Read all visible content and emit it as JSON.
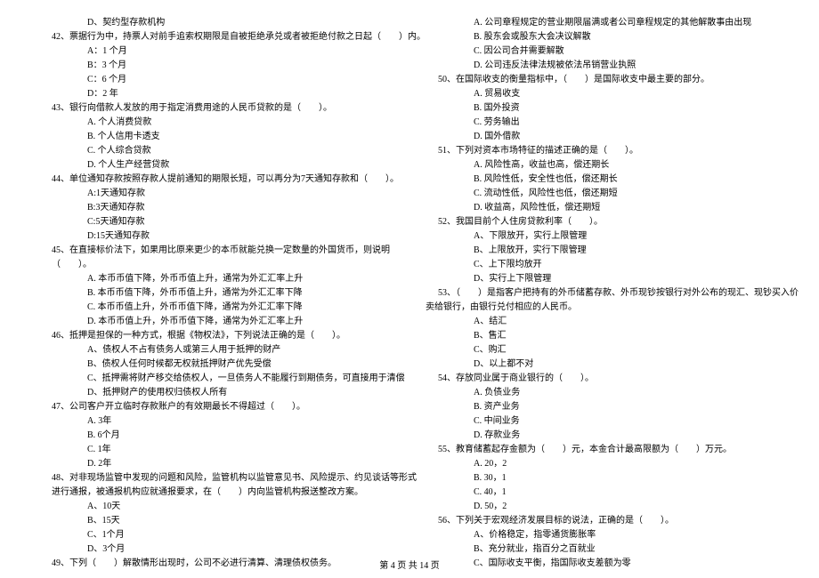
{
  "left_column": {
    "pre_option": "D、契约型存款机构",
    "questions": [
      {
        "num": "42",
        "stem": "票据行为中，持票人对前手追索权期限是自被拒绝承兑或者被拒绝付款之日起（　　）内。",
        "options": [
          "A：1 个月",
          "B：3 个月",
          "C：6 个月",
          "D：2 年"
        ]
      },
      {
        "num": "43",
        "stem": "银行向借款人发放的用于指定消费用途的人民币贷款的是（　　）。",
        "options": [
          "A. 个人消费贷款",
          "B. 个人信用卡透支",
          "C. 个人综合贷款",
          "D. 个人生产经营贷款"
        ]
      },
      {
        "num": "44",
        "stem": "单位通知存款按照存款人提前通知的期限长短，可以再分为7天通知存款和（　　）。",
        "options": [
          "A:1天通知存款",
          "B:3天通知存款",
          "C:5天通知存款",
          "D:15天通知存款"
        ]
      },
      {
        "num": "45",
        "stem": "在直接标价法下，如果用比原来更少的本币就能兑换一定数量的外国货币，则说明",
        "stem_cont": "（　　）。",
        "options": [
          "A. 本币币值下降，外币币值上升，通常为外汇汇率上升",
          "B. 本币币值下降，外币币值上升，通常为外汇汇率下降",
          "C. 本币币值上升，外币币值下降，通常为外汇汇率下降",
          "D. 本币币值上升，外币币值下降，通常为外汇汇率上升"
        ]
      },
      {
        "num": "46",
        "stem": "抵押是担保的一种方式，根据《物权法》，下列说法正确的是（　　）。",
        "options": [
          "A、债权人不占有债务人或第三人用于抵押的财产",
          "B、债权人任何时候都无权就抵押财产优先受偿",
          "C、抵押需将财产移交给债权人，一旦债务人不能履行到期债务，可直接用于清偿",
          "D、抵押财产的使用权归债权人所有"
        ]
      },
      {
        "num": "47",
        "stem": "公司客户开立临时存款账户的有效期最长不得超过（　　）。",
        "options": [
          "A. 3年",
          "B. 6个月",
          "C. 1年",
          "D. 2年"
        ]
      },
      {
        "num": "48",
        "stem": "对非现场监管中发现的问题和风险，监管机构以监管意见书、风险提示、约见谈话等形式",
        "stem_cont": "进行通报，被通报机构应就通报要求，在（　　）内向监管机构报送整改方案。",
        "options": [
          "A、10天",
          "B、15天",
          "C、1个月",
          "D、3个月"
        ]
      },
      {
        "num": "49",
        "stem": "下列（　　）解散情形出现时，公司不必进行清算、清理债权债务。"
      }
    ]
  },
  "right_column": {
    "pre_options": [
      "A. 公司章程规定的营业期限届满或者公司章程规定的其他解散事由出现",
      "B. 股东会或股东大会决议解散",
      "C. 因公司合并需要解散",
      "D. 公司违反法律法规被依法吊销营业执照"
    ],
    "questions": [
      {
        "num": "50",
        "stem": "在国际收支的衡量指标中，（　　）是国际收支中最主要的部分。",
        "options": [
          "A. 贸易收支",
          "B. 国外投资",
          "C. 劳务输出",
          "D. 国外借款"
        ]
      },
      {
        "num": "51",
        "stem": "下列对资本市场特征的描述正确的是（　　）。",
        "options": [
          "A. 风险性高，收益也高，偿还期长",
          "B. 风险性低，安全性也低，偿还期长",
          "C. 流动性低，风险性也低，偿还期短",
          "D. 收益高，风险性低，偿还期短"
        ]
      },
      {
        "num": "52",
        "stem": "我国目前个人住房贷款利率（　　）。",
        "options": [
          "A、下限放开，实行上限管理",
          "B、上限放开，实行下限管理",
          "C、上下限均放开",
          "D、实行上下限管理"
        ]
      },
      {
        "num": "53",
        "stem": "（　　）是指客户把持有的外币储蓄存款、外币现钞按银行对外公布的现汇、现钞买入价",
        "stem_cont": "卖给银行，由银行兑付相应的人民币。",
        "options": [
          "A、结汇",
          "B、售汇",
          "C、购汇",
          "D、以上都不对"
        ]
      },
      {
        "num": "54",
        "stem": "存放同业属于商业银行的（　　）。",
        "options": [
          "A. 负债业务",
          "B. 资产业务",
          "C. 中间业务",
          "D. 存款业务"
        ]
      },
      {
        "num": "55",
        "stem": "教育储蓄起存金额为（　　）元，本金合计最高限额为（　　）万元。",
        "options": [
          "A. 20，2",
          "B. 30，1",
          "C. 40，1",
          "D. 50，2"
        ]
      },
      {
        "num": "56",
        "stem": "下列关于宏观经济发展目标的说法，正确的是（　　）。",
        "options": [
          "A、价格稳定，指零通货膨胀率",
          "B、充分就业，指百分之百就业",
          "C、国际收支平衡，指国际收支差额为零"
        ]
      }
    ]
  },
  "footer": "第 4 页 共 14 页"
}
